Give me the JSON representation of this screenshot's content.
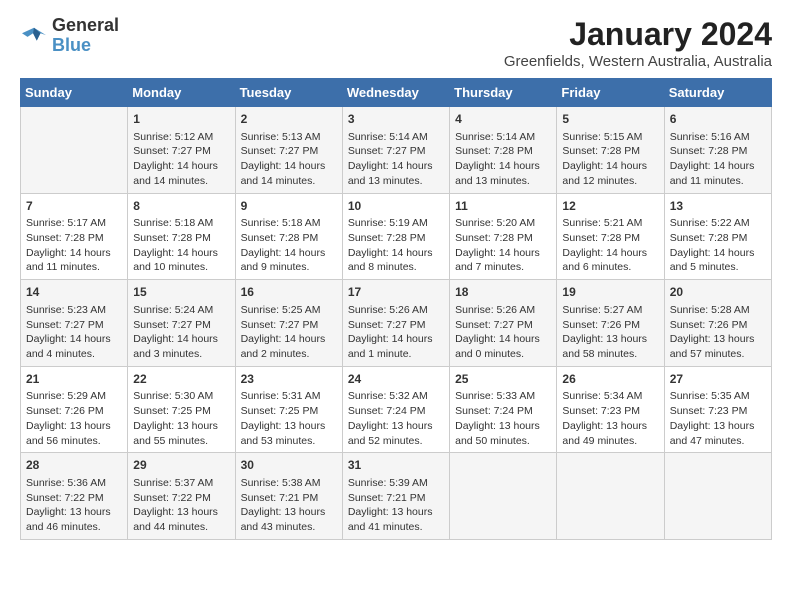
{
  "header": {
    "logo_line1": "General",
    "logo_line2": "Blue",
    "month_title": "January 2024",
    "location": "Greenfields, Western Australia, Australia"
  },
  "columns": [
    "Sunday",
    "Monday",
    "Tuesday",
    "Wednesday",
    "Thursday",
    "Friday",
    "Saturday"
  ],
  "weeks": [
    [
      {
        "day": "",
        "info": ""
      },
      {
        "day": "1",
        "info": "Sunrise: 5:12 AM\nSunset: 7:27 PM\nDaylight: 14 hours\nand 14 minutes."
      },
      {
        "day": "2",
        "info": "Sunrise: 5:13 AM\nSunset: 7:27 PM\nDaylight: 14 hours\nand 14 minutes."
      },
      {
        "day": "3",
        "info": "Sunrise: 5:14 AM\nSunset: 7:27 PM\nDaylight: 14 hours\nand 13 minutes."
      },
      {
        "day": "4",
        "info": "Sunrise: 5:14 AM\nSunset: 7:28 PM\nDaylight: 14 hours\nand 13 minutes."
      },
      {
        "day": "5",
        "info": "Sunrise: 5:15 AM\nSunset: 7:28 PM\nDaylight: 14 hours\nand 12 minutes."
      },
      {
        "day": "6",
        "info": "Sunrise: 5:16 AM\nSunset: 7:28 PM\nDaylight: 14 hours\nand 11 minutes."
      }
    ],
    [
      {
        "day": "7",
        "info": "Sunrise: 5:17 AM\nSunset: 7:28 PM\nDaylight: 14 hours\nand 11 minutes."
      },
      {
        "day": "8",
        "info": "Sunrise: 5:18 AM\nSunset: 7:28 PM\nDaylight: 14 hours\nand 10 minutes."
      },
      {
        "day": "9",
        "info": "Sunrise: 5:18 AM\nSunset: 7:28 PM\nDaylight: 14 hours\nand 9 minutes."
      },
      {
        "day": "10",
        "info": "Sunrise: 5:19 AM\nSunset: 7:28 PM\nDaylight: 14 hours\nand 8 minutes."
      },
      {
        "day": "11",
        "info": "Sunrise: 5:20 AM\nSunset: 7:28 PM\nDaylight: 14 hours\nand 7 minutes."
      },
      {
        "day": "12",
        "info": "Sunrise: 5:21 AM\nSunset: 7:28 PM\nDaylight: 14 hours\nand 6 minutes."
      },
      {
        "day": "13",
        "info": "Sunrise: 5:22 AM\nSunset: 7:28 PM\nDaylight: 14 hours\nand 5 minutes."
      }
    ],
    [
      {
        "day": "14",
        "info": "Sunrise: 5:23 AM\nSunset: 7:27 PM\nDaylight: 14 hours\nand 4 minutes."
      },
      {
        "day": "15",
        "info": "Sunrise: 5:24 AM\nSunset: 7:27 PM\nDaylight: 14 hours\nand 3 minutes."
      },
      {
        "day": "16",
        "info": "Sunrise: 5:25 AM\nSunset: 7:27 PM\nDaylight: 14 hours\nand 2 minutes."
      },
      {
        "day": "17",
        "info": "Sunrise: 5:26 AM\nSunset: 7:27 PM\nDaylight: 14 hours\nand 1 minute."
      },
      {
        "day": "18",
        "info": "Sunrise: 5:26 AM\nSunset: 7:27 PM\nDaylight: 14 hours\nand 0 minutes."
      },
      {
        "day": "19",
        "info": "Sunrise: 5:27 AM\nSunset: 7:26 PM\nDaylight: 13 hours\nand 58 minutes."
      },
      {
        "day": "20",
        "info": "Sunrise: 5:28 AM\nSunset: 7:26 PM\nDaylight: 13 hours\nand 57 minutes."
      }
    ],
    [
      {
        "day": "21",
        "info": "Sunrise: 5:29 AM\nSunset: 7:26 PM\nDaylight: 13 hours\nand 56 minutes."
      },
      {
        "day": "22",
        "info": "Sunrise: 5:30 AM\nSunset: 7:25 PM\nDaylight: 13 hours\nand 55 minutes."
      },
      {
        "day": "23",
        "info": "Sunrise: 5:31 AM\nSunset: 7:25 PM\nDaylight: 13 hours\nand 53 minutes."
      },
      {
        "day": "24",
        "info": "Sunrise: 5:32 AM\nSunset: 7:24 PM\nDaylight: 13 hours\nand 52 minutes."
      },
      {
        "day": "25",
        "info": "Sunrise: 5:33 AM\nSunset: 7:24 PM\nDaylight: 13 hours\nand 50 minutes."
      },
      {
        "day": "26",
        "info": "Sunrise: 5:34 AM\nSunset: 7:23 PM\nDaylight: 13 hours\nand 49 minutes."
      },
      {
        "day": "27",
        "info": "Sunrise: 5:35 AM\nSunset: 7:23 PM\nDaylight: 13 hours\nand 47 minutes."
      }
    ],
    [
      {
        "day": "28",
        "info": "Sunrise: 5:36 AM\nSunset: 7:22 PM\nDaylight: 13 hours\nand 46 minutes."
      },
      {
        "day": "29",
        "info": "Sunrise: 5:37 AM\nSunset: 7:22 PM\nDaylight: 13 hours\nand 44 minutes."
      },
      {
        "day": "30",
        "info": "Sunrise: 5:38 AM\nSunset: 7:21 PM\nDaylight: 13 hours\nand 43 minutes."
      },
      {
        "day": "31",
        "info": "Sunrise: 5:39 AM\nSunset: 7:21 PM\nDaylight: 13 hours\nand 41 minutes."
      },
      {
        "day": "",
        "info": ""
      },
      {
        "day": "",
        "info": ""
      },
      {
        "day": "",
        "info": ""
      }
    ]
  ]
}
